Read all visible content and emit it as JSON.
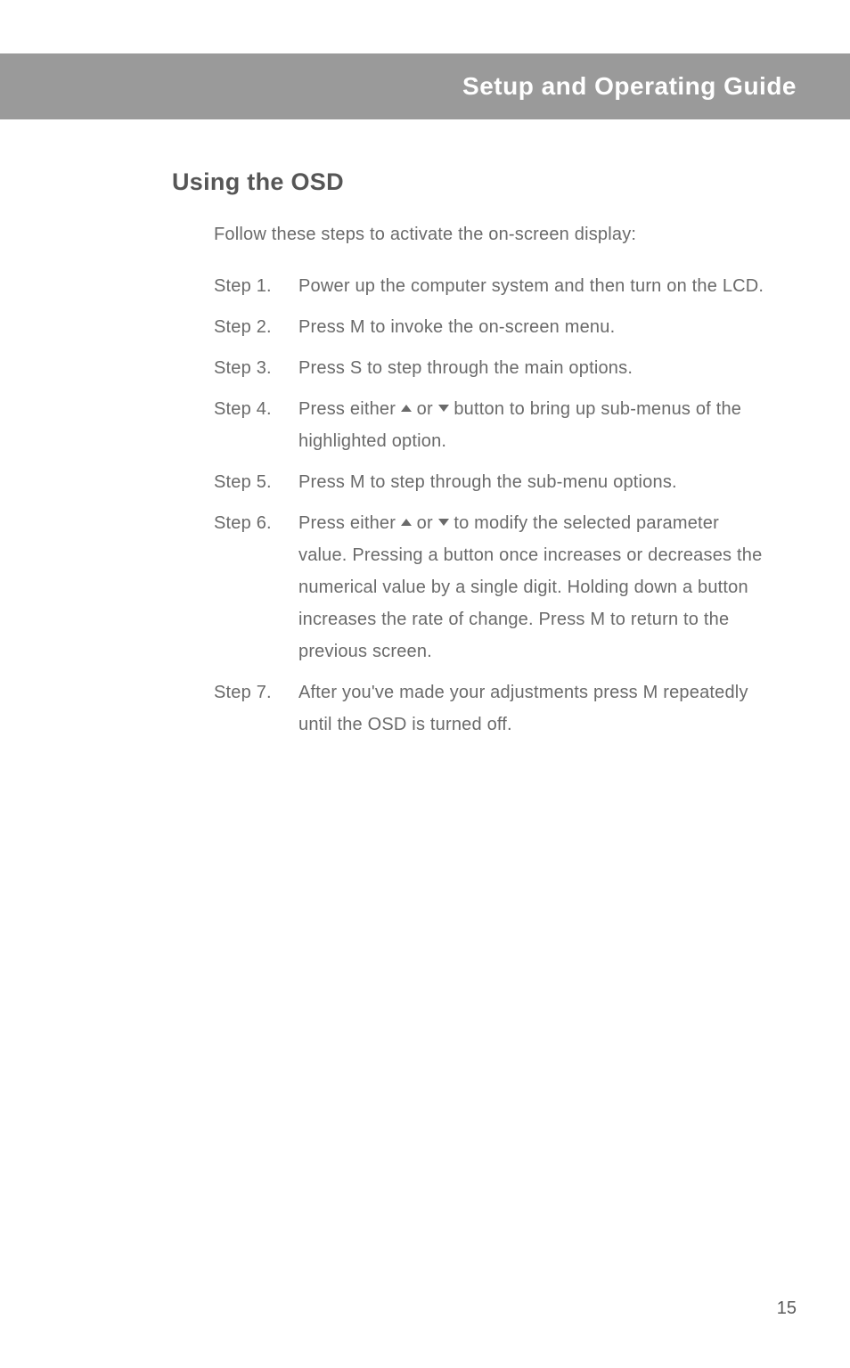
{
  "header": {
    "title": "Setup and Operating Guide"
  },
  "section": {
    "title": "Using the OSD",
    "intro": "Follow these steps to activate the on-screen display:",
    "steps": [
      {
        "label": "Step 1.",
        "text": "Power up the computer system and then turn on the LCD."
      },
      {
        "label": "Step 2.",
        "text": "Press M to invoke the on-screen menu."
      },
      {
        "label": "Step 3.",
        "text": "Press S to step through the main options."
      },
      {
        "label": "Step 4.",
        "text_before": "Press either ",
        "text_mid": " or ",
        "text_after": " button to bring up sub-menus of the highlighted option."
      },
      {
        "label": "Step 5.",
        "text": "Press M to step through the sub-menu options."
      },
      {
        "label": "Step 6.",
        "text_before": "Press either ",
        "text_mid": " or ",
        "text_after": " to modify the selected parameter value. Pressing a button once increases or decreases the numerical value by a single digit. Holding down a button increases the rate of change. Press M to return to the previous screen."
      },
      {
        "label": "Step 7.",
        "text": "After you've made your adjustments press M repeatedly until the OSD is turned off."
      }
    ]
  },
  "page_number": "15"
}
